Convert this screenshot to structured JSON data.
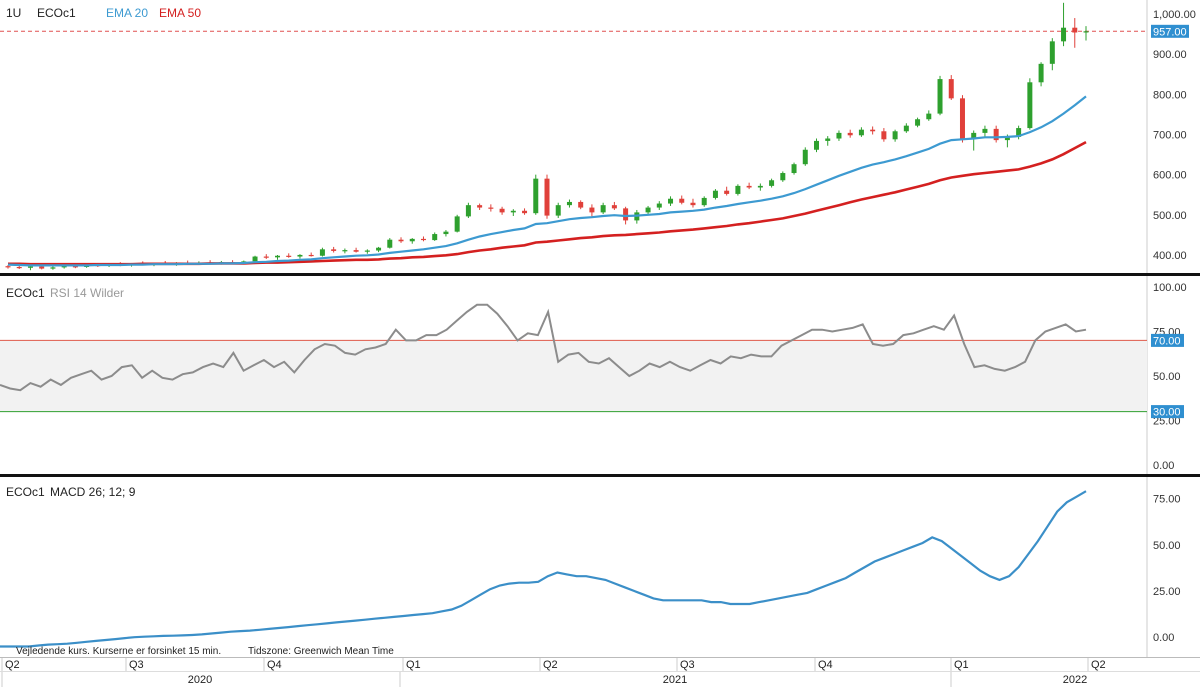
{
  "header": {
    "interval": "1U",
    "symbol": "ECOc1",
    "ema20_label": "EMA 20",
    "ema50_label": "EMA 50"
  },
  "colors": {
    "up": "#2ea02e",
    "down": "#e0403a",
    "ema20": "#3d9ad1",
    "ema50": "#d42020",
    "rsi": "#8c8c8c",
    "macd": "#3b8fc8",
    "price_line": "#e05050",
    "badge": "#2f8fd0",
    "ob": "#e05a4a",
    "os": "#30a030"
  },
  "last_price_label": "957.00",
  "rsi_header": {
    "symbol": "ECOc1",
    "name": "RSI 14 Wilder"
  },
  "rsi_badges": {
    "upper": "70.00",
    "lower": "30.00"
  },
  "macd_header": {
    "symbol": "ECOc1",
    "name": "MACD 26; 12; 9"
  },
  "footer": {
    "note": "Vejledende kurs. Kurserne er forsinket 15 min.",
    "timezone": "Tidszone: Greenwich Mean Time"
  },
  "chart_data": [
    {
      "type": "candlestick",
      "title": "ECOc1",
      "interval": "1U",
      "ylim": [
        360,
        1030
      ],
      "y_ticks": [
        "400.00",
        "500.00",
        "600.00",
        "700.00",
        "800.00",
        "900.00",
        "1,000.00"
      ],
      "last_price": 957.0,
      "x_ticks": [
        "Q2",
        "Q3",
        "Q4",
        "Q1",
        "Q2",
        "Q3",
        "Q4",
        "Q1",
        "Q2"
      ],
      "years": [
        "2020",
        "2021",
        "2022"
      ],
      "candles": [
        [
          372,
          375,
          366,
          370
        ],
        [
          370,
          374,
          365,
          368
        ],
        [
          368,
          373,
          362,
          371
        ],
        [
          371,
          376,
          364,
          366
        ],
        [
          366,
          372,
          363,
          369
        ],
        [
          369,
          374,
          366,
          372
        ],
        [
          372,
          377,
          367,
          370
        ],
        [
          370,
          378,
          368,
          375
        ],
        [
          375,
          380,
          370,
          373
        ],
        [
          373,
          379,
          370,
          376
        ],
        [
          376,
          382,
          372,
          374
        ],
        [
          374,
          380,
          371,
          378
        ],
        [
          378,
          384,
          374,
          376
        ],
        [
          376,
          381,
          372,
          379
        ],
        [
          379,
          385,
          375,
          377
        ],
        [
          377,
          382,
          373,
          380
        ],
        [
          380,
          386,
          377,
          378
        ],
        [
          378,
          384,
          375,
          381
        ],
        [
          381,
          387,
          377,
          379
        ],
        [
          379,
          385,
          376,
          382
        ],
        [
          382,
          387,
          378,
          380
        ],
        [
          380,
          386,
          377,
          384
        ],
        [
          384,
          398,
          382,
          396
        ],
        [
          396,
          402,
          390,
          394
        ],
        [
          394,
          400,
          388,
          398
        ],
        [
          398,
          404,
          393,
          396
        ],
        [
          396,
          402,
          391,
          400
        ],
        [
          400,
          406,
          396,
          398
        ],
        [
          398,
          418,
          396,
          414
        ],
        [
          414,
          420,
          406,
          410
        ],
        [
          410,
          416,
          404,
          412
        ],
        [
          412,
          418,
          406,
          408
        ],
        [
          408,
          414,
          403,
          411
        ],
        [
          411,
          420,
          407,
          418
        ],
        [
          418,
          442,
          416,
          438
        ],
        [
          438,
          444,
          430,
          434
        ],
        [
          434,
          442,
          428,
          440
        ],
        [
          440,
          446,
          434,
          437
        ],
        [
          437,
          456,
          435,
          452
        ],
        [
          452,
          462,
          446,
          458
        ],
        [
          458,
          500,
          456,
          496
        ],
        [
          496,
          530,
          492,
          524
        ],
        [
          524,
          528,
          512,
          518
        ],
        [
          518,
          526,
          508,
          515
        ],
        [
          515,
          520,
          500,
          506
        ],
        [
          506,
          514,
          497,
          510
        ],
        [
          510,
          516,
          500,
          504
        ],
        [
          504,
          600,
          500,
          590
        ],
        [
          590,
          600,
          490,
          498
        ],
        [
          498,
          530,
          492,
          524
        ],
        [
          524,
          538,
          518,
          532
        ],
        [
          532,
          536,
          514,
          518
        ],
        [
          518,
          526,
          496,
          506
        ],
        [
          506,
          530,
          502,
          524
        ],
        [
          524,
          532,
          512,
          516
        ],
        [
          516,
          520,
          476,
          486
        ],
        [
          486,
          512,
          478,
          506
        ],
        [
          506,
          522,
          498,
          518
        ],
        [
          518,
          534,
          512,
          528
        ],
        [
          528,
          546,
          522,
          540
        ],
        [
          540,
          548,
          526,
          530
        ],
        [
          530,
          540,
          518,
          524
        ],
        [
          524,
          546,
          520,
          542
        ],
        [
          542,
          564,
          538,
          560
        ],
        [
          560,
          570,
          548,
          552
        ],
        [
          552,
          576,
          548,
          572
        ],
        [
          572,
          580,
          564,
          568
        ],
        [
          568,
          578,
          560,
          572
        ],
        [
          572,
          590,
          568,
          586
        ],
        [
          586,
          608,
          582,
          604
        ],
        [
          604,
          630,
          600,
          626
        ],
        [
          626,
          668,
          622,
          662
        ],
        [
          662,
          690,
          656,
          684
        ],
        [
          684,
          696,
          672,
          690
        ],
        [
          690,
          710,
          684,
          704
        ],
        [
          704,
          712,
          692,
          698
        ],
        [
          698,
          718,
          694,
          712
        ],
        [
          712,
          720,
          700,
          708
        ],
        [
          708,
          716,
          682,
          688
        ],
        [
          688,
          712,
          682,
          708
        ],
        [
          708,
          728,
          704,
          722
        ],
        [
          722,
          742,
          718,
          738
        ],
        [
          738,
          760,
          734,
          752
        ],
        [
          752,
          846,
          748,
          838
        ],
        [
          838,
          848,
          786,
          790
        ],
        [
          790,
          798,
          680,
          690
        ],
        [
          690,
          710,
          660,
          704
        ],
        [
          704,
          722,
          694,
          714
        ],
        [
          714,
          722,
          680,
          686
        ],
        [
          686,
          700,
          668,
          694
        ],
        [
          694,
          722,
          688,
          716
        ],
        [
          716,
          840,
          712,
          830
        ],
        [
          830,
          880,
          820,
          876
        ],
        [
          876,
          940,
          860,
          932
        ],
        [
          932,
          1028,
          920,
          966
        ],
        [
          966,
          990,
          916,
          954
        ],
        [
          954,
          970,
          934,
          957
        ]
      ],
      "ema20": [
        376,
        375,
        374,
        374,
        374,
        374,
        374,
        374,
        375,
        375,
        375,
        376,
        376,
        377,
        377,
        377,
        378,
        378,
        378,
        379,
        379,
        380,
        382,
        383,
        385,
        386,
        388,
        389,
        392,
        394,
        396,
        398,
        399,
        401,
        405,
        408,
        411,
        414,
        418,
        422,
        429,
        438,
        446,
        452,
        457,
        462,
        466,
        477,
        479,
        484,
        489,
        492,
        494,
        497,
        499,
        497,
        498,
        500,
        502,
        506,
        508,
        510,
        513,
        518,
        522,
        527,
        531,
        535,
        540,
        546,
        554,
        564,
        575,
        586,
        597,
        607,
        617,
        625,
        631,
        638,
        646,
        655,
        664,
        677,
        686,
        688,
        690,
        693,
        693,
        694,
        696,
        706,
        718,
        733,
        752,
        773,
        795
      ],
      "ema50": [
        378,
        378,
        377,
        377,
        377,
        377,
        377,
        377,
        377,
        377,
        377,
        377,
        378,
        378,
        378,
        378,
        378,
        378,
        379,
        379,
        379,
        379,
        380,
        381,
        381,
        382,
        383,
        384,
        385,
        386,
        387,
        388,
        388,
        389,
        391,
        392,
        394,
        395,
        397,
        399,
        402,
        407,
        411,
        414,
        418,
        421,
        424,
        431,
        433,
        436,
        439,
        442,
        444,
        447,
        449,
        450,
        452,
        454,
        456,
        459,
        461,
        463,
        466,
        469,
        472,
        476,
        479,
        483,
        487,
        491,
        497,
        503,
        510,
        517,
        524,
        531,
        538,
        544,
        550,
        556,
        563,
        570,
        577,
        586,
        593,
        597,
        601,
        604,
        607,
        610,
        613,
        620,
        628,
        638,
        651,
        666,
        681
      ]
    },
    {
      "type": "line",
      "title": "RSI 14 Wilder",
      "ylim": [
        0,
        100
      ],
      "y_ticks": [
        "0.00",
        "25.00",
        "50.00",
        "75.00",
        "100.00"
      ],
      "overbought": 70,
      "oversold": 30,
      "values": [
        45,
        43,
        42,
        46,
        44,
        48,
        45,
        49,
        51,
        53,
        48,
        50,
        55,
        56,
        49,
        53,
        49,
        48,
        51,
        52,
        55,
        57,
        55,
        63,
        53,
        56,
        59,
        55,
        58,
        52,
        59,
        65,
        68,
        67,
        63,
        62,
        65,
        66,
        68,
        76,
        70,
        70,
        73,
        73,
        76,
        81,
        86,
        90,
        90,
        85,
        78,
        70,
        74,
        73,
        86,
        58,
        62,
        63,
        58,
        57,
        60,
        55,
        50,
        53,
        57,
        55,
        58,
        55,
        53,
        56,
        59,
        57,
        61,
        60,
        62,
        61,
        61,
        67,
        70,
        73,
        76,
        76,
        75,
        76,
        77,
        79,
        68,
        67,
        68,
        73,
        74,
        76,
        78,
        76,
        84,
        68,
        55,
        56,
        54,
        53,
        55,
        58,
        70,
        75,
        77,
        79,
        75,
        76
      ]
    },
    {
      "type": "line",
      "title": "MACD 26; 12; 9",
      "ylim": [
        -8,
        84
      ],
      "y_ticks": [
        "0.00",
        "25.00",
        "50.00",
        "75.00"
      ],
      "values": [
        -5,
        -5,
        -5,
        -5,
        -4.5,
        -4,
        -3.8,
        -3.5,
        -3,
        -2.5,
        -2,
        -1.5,
        -1,
        -0.5,
        0,
        0.3,
        0.5,
        0.7,
        0.8,
        1,
        1.2,
        1.5,
        2,
        2.5,
        3,
        3.3,
        3.6,
        4,
        4.5,
        5,
        5.5,
        6,
        6.5,
        7,
        7.5,
        8,
        8.5,
        9,
        9.5,
        10,
        10.5,
        11,
        11.5,
        12,
        12.5,
        13,
        14,
        15,
        17,
        20,
        23,
        26,
        28,
        29,
        29.5,
        29.5,
        30,
        33,
        35,
        34,
        33,
        33,
        32,
        31,
        29,
        27,
        25,
        23,
        21,
        20,
        20,
        20,
        20,
        20,
        19,
        19,
        18,
        18,
        18,
        19,
        20,
        21,
        22,
        23,
        24,
        26,
        28,
        30,
        32,
        35,
        38,
        41,
        43,
        45,
        47,
        49,
        51,
        54,
        52,
        48,
        44,
        40,
        36,
        33,
        31,
        33,
        38,
        45,
        52,
        60,
        68,
        73,
        76,
        79
      ]
    }
  ]
}
